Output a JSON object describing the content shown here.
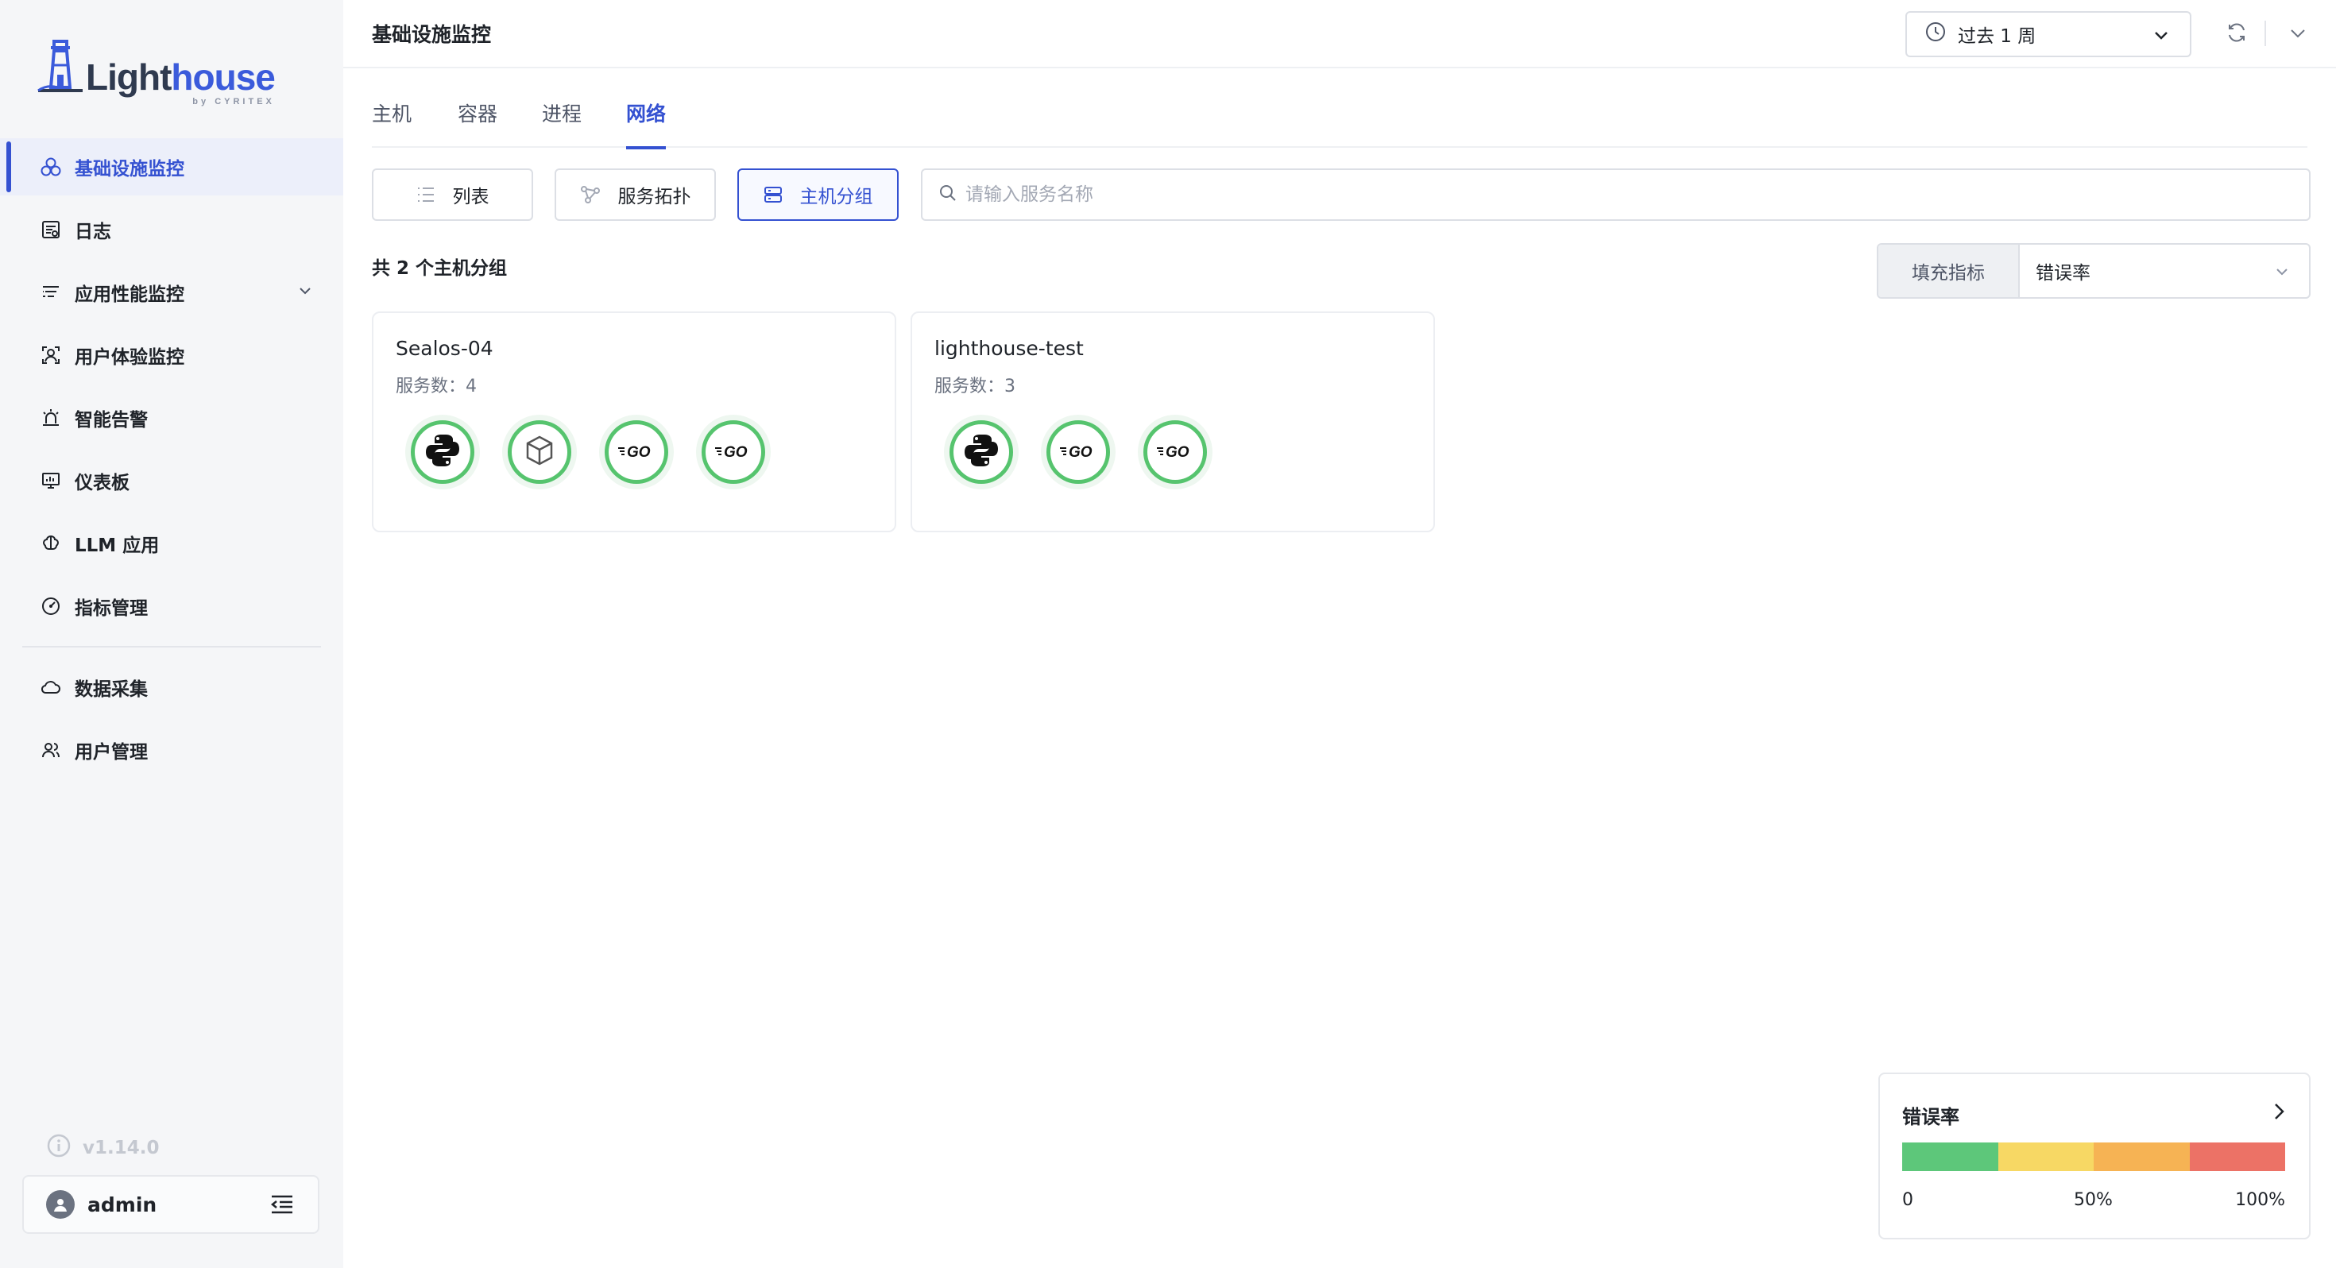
{
  "app": {
    "logo_main": "Light",
    "logo_accent": "house",
    "logo_sub": "by CYRITEX",
    "version": "v1.14.0",
    "user": "admin",
    "colors": {
      "accent": "#3451d1",
      "service_ring": "#56c46e"
    }
  },
  "sidebar": {
    "items": [
      {
        "label": "基础设施监控",
        "icon": "infrastructure-icon",
        "active": true
      },
      {
        "label": "日志",
        "icon": "log-icon"
      },
      {
        "label": "应用性能监控",
        "icon": "apm-icon",
        "expandable": true
      },
      {
        "label": "用户体验监控",
        "icon": "user-experience-icon"
      },
      {
        "label": "智能告警",
        "icon": "alarm-icon"
      },
      {
        "label": "仪表板",
        "icon": "dashboard-icon"
      },
      {
        "label": "LLM 应用",
        "icon": "llm-brain-icon"
      },
      {
        "label": "指标管理",
        "icon": "metrics-gauge-icon"
      }
    ],
    "items_after_divider": [
      {
        "label": "数据采集",
        "icon": "data-collection-icon"
      },
      {
        "label": "用户管理",
        "icon": "user-management-icon"
      }
    ]
  },
  "header": {
    "title": "基础设施监控",
    "time_range": "过去 1 周"
  },
  "tabs": [
    {
      "label": "主机"
    },
    {
      "label": "容器"
    },
    {
      "label": "进程"
    },
    {
      "label": "网络",
      "active": true
    }
  ],
  "toolbar": {
    "list_label": "列表",
    "topology_label": "服务拓扑",
    "group_label": "主机分组",
    "search_placeholder": "请输入服务名称"
  },
  "summary": {
    "count_text": "共 2 个主机分组",
    "metric_label": "填充指标",
    "metric_value": "错误率"
  },
  "groups": [
    {
      "name": "Sealos-04",
      "service_count_text": "服务数：4",
      "services": [
        "python-icon",
        "package-box-icon",
        "go-icon",
        "go-icon"
      ]
    },
    {
      "name": "lighthouse-test",
      "service_count_text": "服务数：3",
      "services": [
        "python-icon",
        "go-icon",
        "go-icon"
      ]
    }
  ],
  "legend": {
    "title": "错误率",
    "colors": [
      "#5dc77a",
      "#f7d864",
      "#f6b354",
      "#ec7266"
    ],
    "tick_min": "0",
    "tick_mid": "50%",
    "tick_max": "100%"
  }
}
